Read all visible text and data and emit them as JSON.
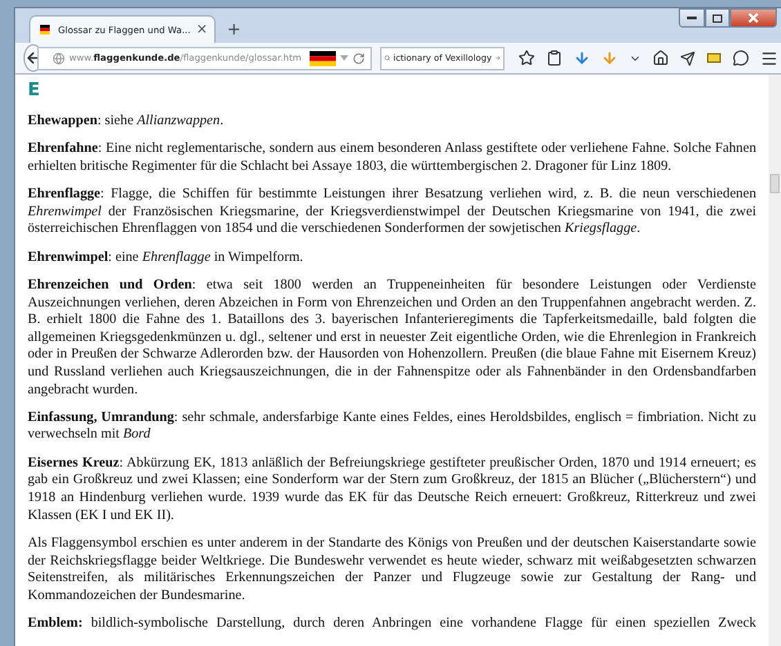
{
  "tab": {
    "title": "Glossar zu Flaggen und Wa...",
    "close": "×"
  },
  "new_tab": "+",
  "address": {
    "prefix": "www.",
    "domain": "flaggenkunde.de",
    "path": "/flaggenkunde/glossar.htm"
  },
  "search": {
    "value": "ictionary of Vexillology"
  },
  "heading": "E",
  "paragraphs": [
    {
      "text": "**Ehewappen**: siehe *Allianzwappen*."
    },
    {
      "text": "**Ehrenfahne**: Eine nicht reglementarische, sondern aus einem besonderen Anlass gestiftete oder verliehene Fahne. Solche Fahnen erhielten britische Regimenter für die Schlacht bei Assaye 1803, die württembergischen 2. Dragoner für Linz 1809."
    },
    {
      "text": "**Ehrenflagge**: Flagge, die Schiffen für bestimmte Leistungen ihrer Besatzung verliehen wird, z. B. die neun verschiedenen *Ehrenwimpel* der Französischen Kriegsmarine, der Kriegsverdienstwimpel der Deutschen Kriegsmarine von 1941, die zwei österreichischen Ehrenflaggen von 1854 und die verschiedenen Sonderformen der sowjetischen *Kriegsflagge*."
    },
    {
      "text": "**Ehrenwimpel**: eine *Ehrenflagge* in Wimpelform."
    },
    {
      "text": "**Ehrenzeichen und Orden**: etwa seit 1800 werden an Truppeneinheiten für besondere Leistungen oder Verdienste Auszeichnungen verliehen, deren Abzeichen in Form von Ehrenzeichen und Orden an den Truppenfahnen angebracht werden. Z. B. erhielt 1800 die Fahne des 1. Bataillons des 3. bayerischen Infanterieregiments die Tapferkeitsmedaille, bald folgten die allgemeinen Kriegsgedenkmünzen u. dgl., seltener und erst in neuester Zeit eigentliche Orden, wie die Ehrenlegion in Frankreich oder in Preußen der Schwarze Adlerorden bzw. der Hausorden von Hohenzollern. Preußen (die blaue Fahne mit Eisernem Kreuz) und Russland verliehen auch Kriegsauszeichnungen, die in der Fahnenspitze oder als Fahnenbänder in den Ordensbandfarben angebracht wurden."
    },
    {
      "text": "**Einfassung, Umrandung**: sehr schmale, andersfarbige Kante eines Feldes, eines Heroldsbildes, englisch = fimbriation. Nicht zu verwechseln mit *Bord*"
    },
    {
      "text": "**Eisernes Kreuz**: Abkürzung EK, 1813 anläßlich der Befreiungskriege gestifteter preußischer Orden, 1870 und 1914 erneuert; es gab ein Großkreuz und zwei Klassen; eine Sonderform war der Stern zum Großkreuz, der 1815 an Blücher („Blücherstern“) und 1918 an Hindenburg verliehen wurde. 1939 wurde das EK für das Deutsche Reich erneuert: Großkreuz, Ritterkreuz und zwei Klassen (EK I und EK II)."
    },
    {
      "text": "Als Flaggensymbol erschien es unter anderem in der Standarte des Königs von Preußen und der deutschen Kaiserstandarte sowie der Reichskriegsflagge beider Weltkriege. Die Bundeswehr verwendet es heute wieder, schwarz mit weißabgesetzten schwarzen Seitenstreifen, als militärisches Erkennungszeichen der Panzer und Flugzeuge sowie zur Gestaltung der Rang- und Kommandozeichen der Bundesmarine."
    },
    {
      "text": "**Emblem:** bildlich-symbolische Darstellung, durch deren Anbringen eine vorhandene Flagge für einen speziellen Zweck",
      "continues": true
    }
  ]
}
